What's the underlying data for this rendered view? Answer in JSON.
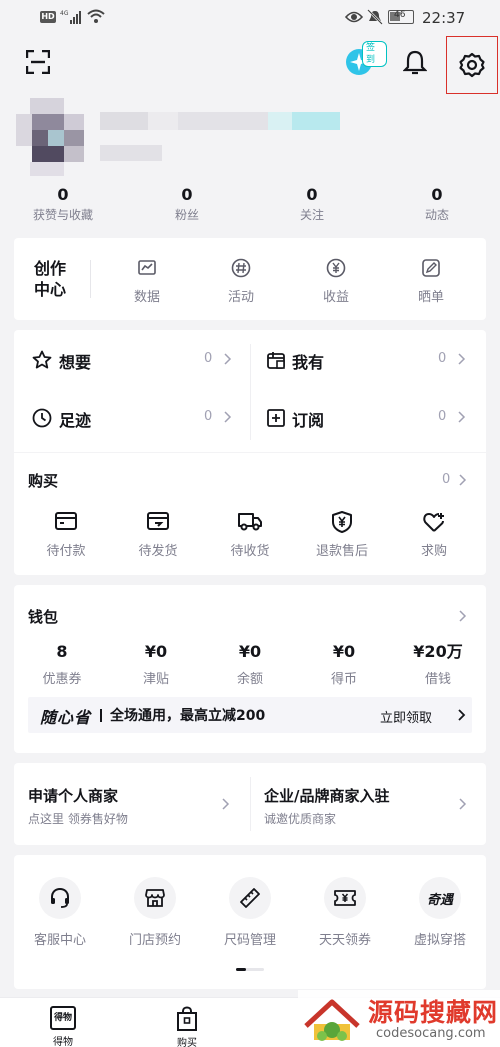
{
  "status_bar": {
    "left": "HD 4G",
    "time": "22:37",
    "battery": "46"
  },
  "header": {
    "checkin_badge": "签到"
  },
  "stats": [
    {
      "value": "0",
      "label": "获赞与收藏"
    },
    {
      "value": "0",
      "label": "粉丝"
    },
    {
      "value": "0",
      "label": "关注"
    },
    {
      "value": "0",
      "label": "动态"
    }
  ],
  "creation": {
    "title_line1": "创作",
    "title_line2": "中心",
    "items": [
      {
        "label": "数据",
        "icon": "chart-icon"
      },
      {
        "label": "活动",
        "icon": "hash-icon"
      },
      {
        "label": "收益",
        "icon": "yuan-icon"
      },
      {
        "label": "晒单",
        "icon": "edit-icon"
      }
    ]
  },
  "quick_grid": [
    {
      "label": "想要",
      "count": "0",
      "icon": "star-icon"
    },
    {
      "label": "我有",
      "count": "0",
      "icon": "box-icon"
    },
    {
      "label": "足迹",
      "count": "0",
      "icon": "clock-icon"
    },
    {
      "label": "订阅",
      "count": "0",
      "icon": "plus-square-icon"
    }
  ],
  "purchase": {
    "title": "购买",
    "count": "0",
    "items": [
      {
        "label": "待付款",
        "icon": "wallet-icon"
      },
      {
        "label": "待发货",
        "icon": "package-icon"
      },
      {
        "label": "待收货",
        "icon": "truck-icon"
      },
      {
        "label": "退款售后",
        "icon": "shield-yuan-icon"
      },
      {
        "label": "求购",
        "icon": "heart-plus-icon"
      }
    ]
  },
  "wallet": {
    "title": "钱包",
    "items": [
      {
        "value": "8",
        "label": "优惠券"
      },
      {
        "value": "¥0",
        "label": "津贴"
      },
      {
        "value": "¥0",
        "label": "余额"
      },
      {
        "value": "¥0",
        "label": "得币"
      },
      {
        "value": "¥20万",
        "label": "借钱"
      }
    ],
    "promo_logo": "随心省",
    "promo_text": "全场通用，最高立减200",
    "promo_action": "立即领取"
  },
  "merchant": [
    {
      "title": "申请个人商家",
      "subtitle": "点这里 领券售好物"
    },
    {
      "title": "企业/品牌商家入驻",
      "subtitle": "诚邀优质商家"
    }
  ],
  "services": [
    {
      "label": "客服中心",
      "icon": "headset-icon"
    },
    {
      "label": "门店预约",
      "icon": "store-icon"
    },
    {
      "label": "尺码管理",
      "icon": "ruler-icon"
    },
    {
      "label": "天天领券",
      "icon": "coupon-icon"
    },
    {
      "label": "虚拟穿搭",
      "icon": "qiyu-icon",
      "icon_text": "奇遇"
    }
  ],
  "bottom_nav": [
    {
      "label": "得物",
      "icon_text": "得物"
    },
    {
      "label": "购买",
      "icon_text": "口"
    }
  ],
  "watermark": {
    "text": "源码搜藏网",
    "url": "codesocang.com"
  }
}
